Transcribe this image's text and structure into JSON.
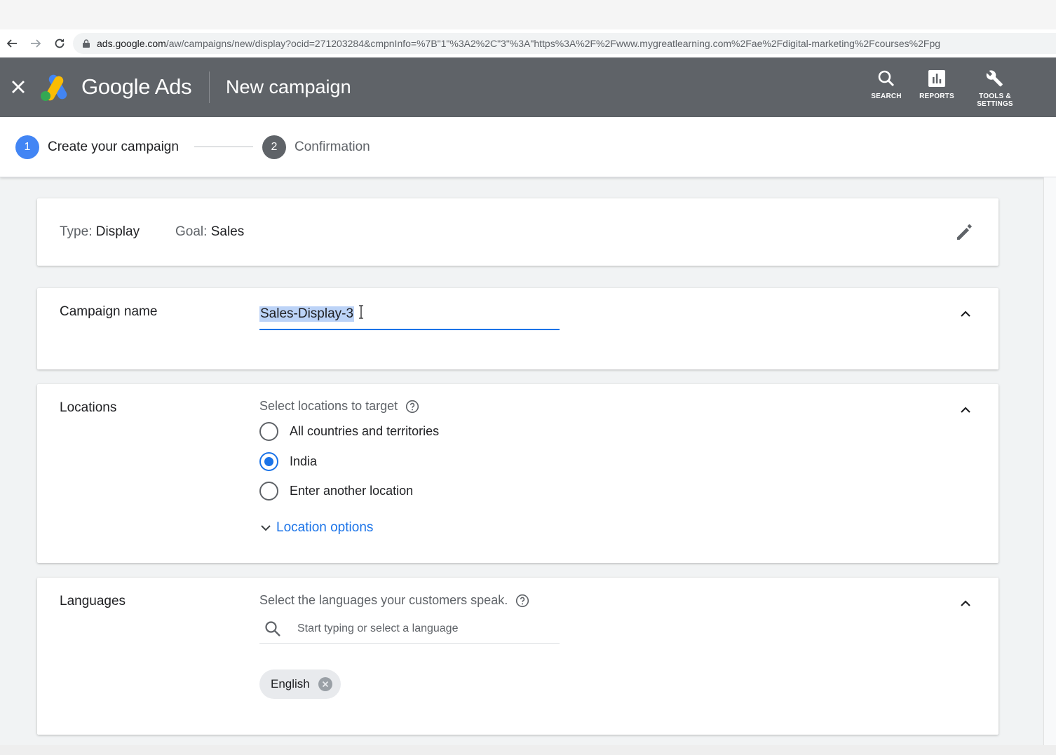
{
  "browser": {
    "url_host": "ads.google.com",
    "url_rest": "/aw/campaigns/new/display?ocid=271203284&cmpnInfo=%7B\"1\"%3A2%2C\"3\"%3A\"https%3A%2F%2Fwww.mygreatlearning.com%2Fae%2Fdigital-marketing%2Fcourses%2Fpg"
  },
  "appbar": {
    "brand": "Google Ads",
    "page_title": "New campaign",
    "actions": [
      {
        "label": "SEARCH",
        "icon": "search-icon"
      },
      {
        "label": "REPORTS",
        "icon": "reports-icon"
      },
      {
        "label": "TOOLS & SETTINGS",
        "icon": "wrench-icon"
      }
    ]
  },
  "stepper": {
    "steps": [
      {
        "number": "1",
        "label": "Create your campaign",
        "state": "active"
      },
      {
        "number": "2",
        "label": "Confirmation",
        "state": "pending"
      }
    ]
  },
  "summary": {
    "type_label": "Type:",
    "type_value": "Display",
    "goal_label": "Goal:",
    "goal_value": "Sales"
  },
  "campaign_name": {
    "title": "Campaign name",
    "value": "Sales-Display-3"
  },
  "locations": {
    "title": "Locations",
    "hint": "Select locations to target",
    "options": [
      {
        "label": "All countries and territories",
        "checked": false
      },
      {
        "label": "India",
        "checked": true
      },
      {
        "label": "Enter another location",
        "checked": false
      }
    ],
    "more_label": "Location options"
  },
  "languages": {
    "title": "Languages",
    "hint": "Select the languages your customers speak.",
    "search_placeholder": "Start typing or select a language",
    "selected": [
      "English"
    ]
  },
  "colors": {
    "appbar": "#5f6368",
    "accent": "#1a73e8",
    "step_active": "#4285f4"
  }
}
